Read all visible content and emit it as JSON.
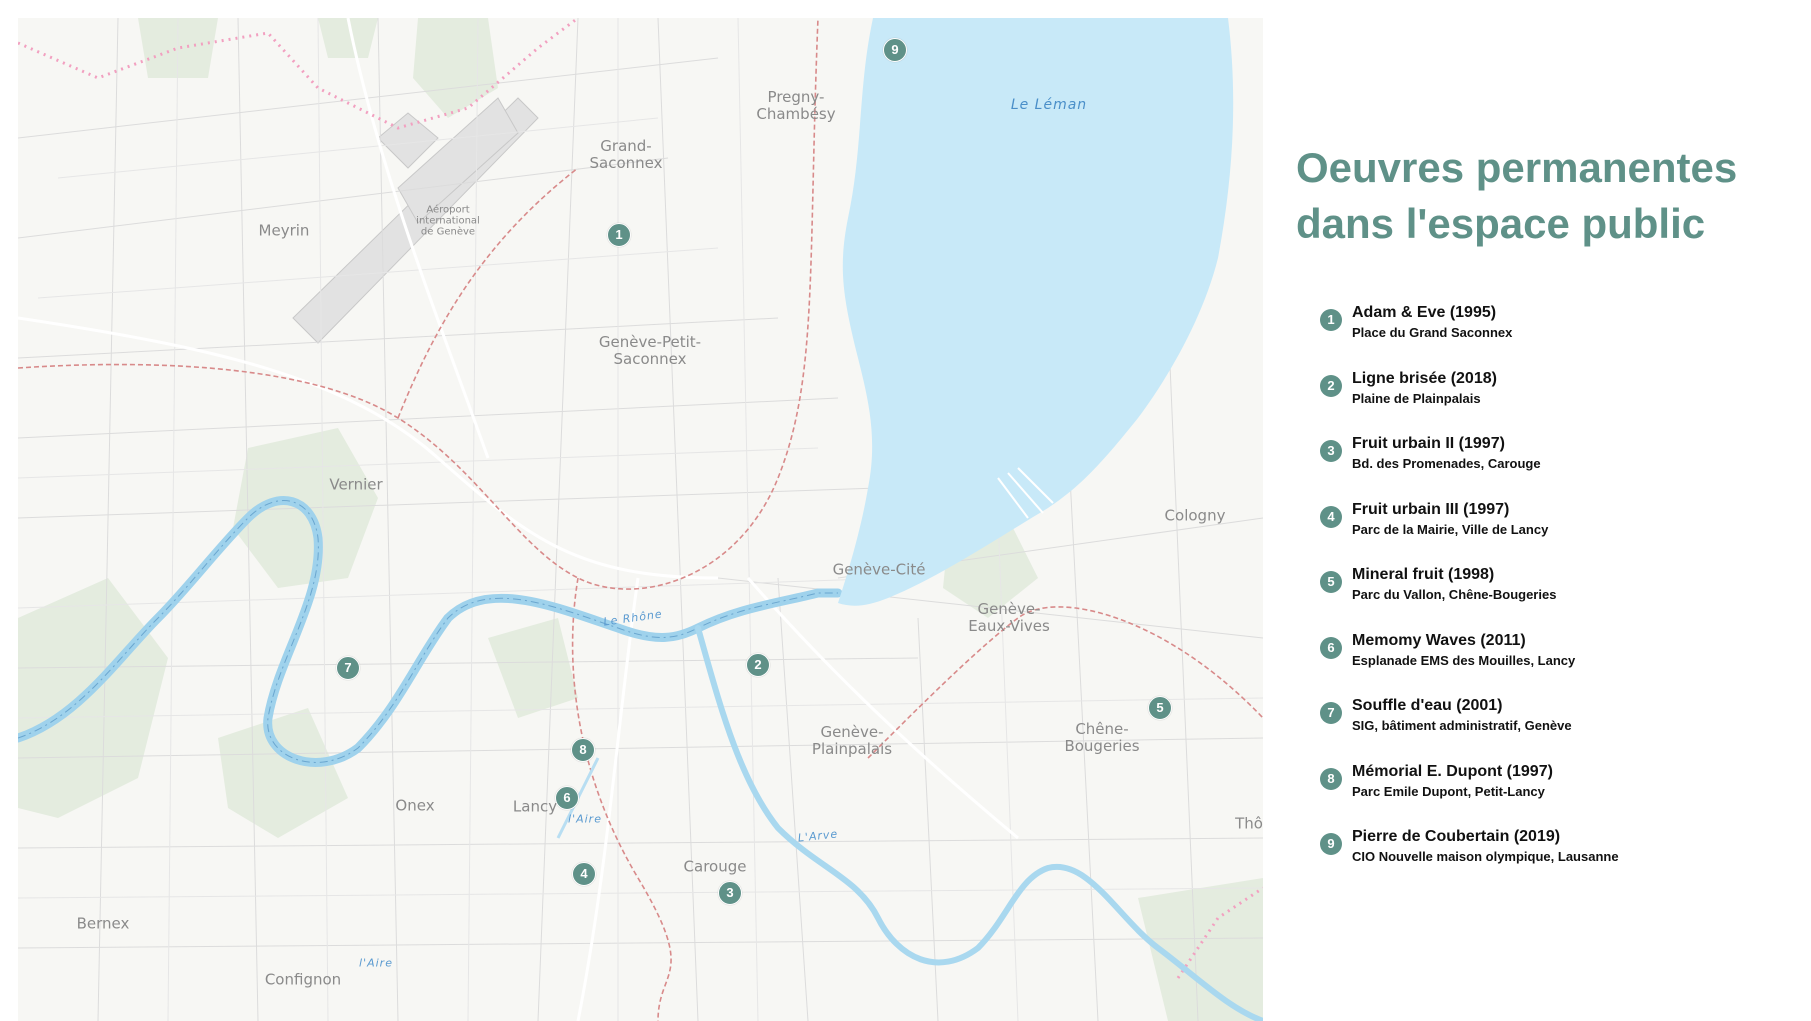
{
  "legend": {
    "title_line1": "Oeuvres permanentes",
    "title_line2": "dans l'espace public",
    "accent_color": "#5f9188",
    "items": [
      {
        "num": "1",
        "title": "Adam & Eve (1995)",
        "location": "Place du Grand Saconnex"
      },
      {
        "num": "2",
        "title": "Ligne brisée (2018)",
        "location": "Plaine de Plainpalais"
      },
      {
        "num": "3",
        "title": "Fruit urbain II (1997)",
        "location": "Bd. des Promenades, Carouge"
      },
      {
        "num": "4",
        "title": "Fruit urbain III (1997)",
        "location": "Parc de la Mairie, Ville de Lancy"
      },
      {
        "num": "5",
        "title": "Mineral fruit (1998)",
        "location": "Parc du Vallon, Chêne-Bougeries"
      },
      {
        "num": "6",
        "title": "Memomy Waves (2011)",
        "location": "Esplanade EMS des Mouilles, Lancy"
      },
      {
        "num": "7",
        "title": "Souffle d'eau (2001)",
        "location": "SIG, bâtiment administratif, Genève"
      },
      {
        "num": "8",
        "title": "Mémorial E. Dupont (1997)",
        "location": "Parc Emile Dupont, Petit-Lancy"
      },
      {
        "num": "9",
        "title": "Pierre de Coubertain (2019)",
        "location": "CIO Nouvelle maison olympique, Lausanne"
      }
    ]
  },
  "map": {
    "lake_color": "#c8e9f8",
    "places": [
      {
        "id": "meyrin",
        "text": "Meyrin"
      },
      {
        "id": "grand-saconnex",
        "text": "Grand-\nSaconnex"
      },
      {
        "id": "pregny",
        "text": "Pregny-\nChambésy"
      },
      {
        "id": "airport",
        "text": "Aéroport\ninternational\nde Genève"
      },
      {
        "id": "petit-saconnex",
        "text": "Genève-Petit-\nSaconnex"
      },
      {
        "id": "vernier",
        "text": "Vernier"
      },
      {
        "id": "cologny",
        "text": "Cologny"
      },
      {
        "id": "geneve-cite",
        "text": "Genève-Cité"
      },
      {
        "id": "eaux-vives",
        "text": "Genève-\nEaux-Vives"
      },
      {
        "id": "plainpalais",
        "text": "Genève-\nPlainpalais"
      },
      {
        "id": "chene",
        "text": "Chêne-\nBougeries"
      },
      {
        "id": "onex",
        "text": "Onex"
      },
      {
        "id": "lancy",
        "text": "Lancy"
      },
      {
        "id": "carouge",
        "text": "Carouge"
      },
      {
        "id": "bernex",
        "text": "Bernex"
      },
      {
        "id": "confignon",
        "text": "Confignon"
      },
      {
        "id": "tho",
        "text": "Thô"
      }
    ],
    "water_labels": [
      {
        "id": "leman",
        "text": "Le Léman"
      },
      {
        "id": "rhone",
        "text": "Le Rhône"
      },
      {
        "id": "arve",
        "text": "L'Arve"
      },
      {
        "id": "aire",
        "text": "l'Aire"
      },
      {
        "id": "aire2",
        "text": "l'Aire"
      }
    ],
    "markers": [
      "1",
      "2",
      "3",
      "4",
      "5",
      "6",
      "7",
      "8",
      "9"
    ]
  }
}
